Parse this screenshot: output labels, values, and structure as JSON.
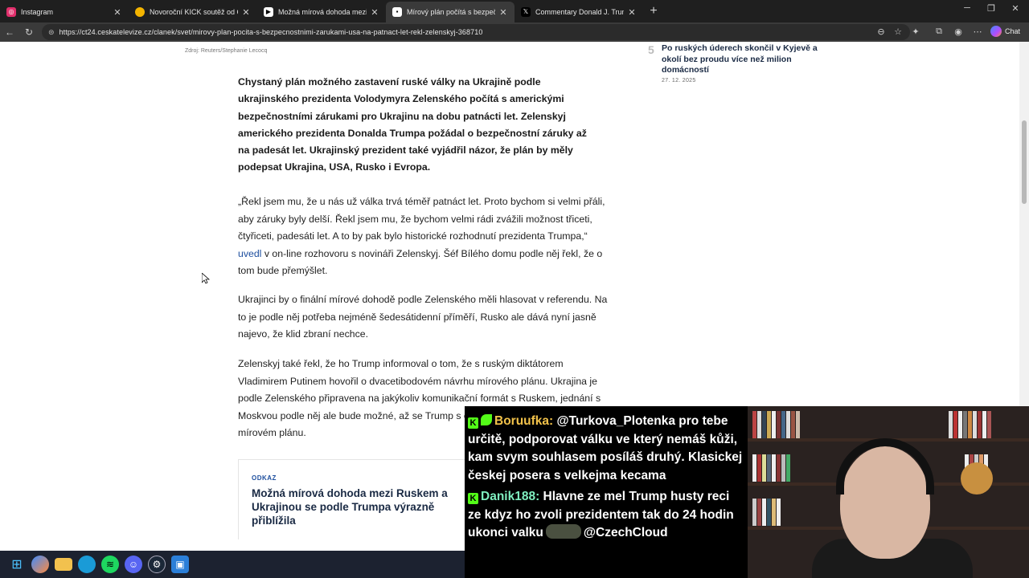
{
  "browser": {
    "tabs": [
      {
        "title": "Instagram",
        "icon": "instagram-icon",
        "color": "#e1306c",
        "active": false
      },
      {
        "title": "Novoroční KICK soutěž od CzechC",
        "icon": "chrome-icon",
        "color": "#f4b400",
        "active": false
      },
      {
        "title": "Možná mírová dohoda mezi Ru",
        "icon": "ct24-icon",
        "color": "#ffffff",
        "active": false
      },
      {
        "title": "Mírový plán počítá s bezpečnos",
        "icon": "ct24-icon",
        "color": "#ffffff",
        "active": true
      },
      {
        "title": "Commentary Donald J. Trump Pos",
        "icon": "x-icon",
        "color": "#000000",
        "active": false
      }
    ],
    "url": "https://ct24.ceskatelevize.cz/clanek/svet/mirovy-plan-pocita-s-bezpecnostnimi-zarukami-usa-na-patnact-let-rekl-zelenskyj-368710",
    "chat_label": "Chat"
  },
  "article": {
    "photo_caption": "Zdroj: Reuters/Stephanie Lecocq",
    "lead": "Chystaný plán možného zastavení ruské války na Ukrajině podle ukrajinského prezidenta Volodymyra Zelenského počítá s americkými bezpečnostními zárukami pro Ukrajinu na dobu patnácti let. Zelenskyj amerického prezidenta Donalda Trumpa požádal o bezpečnostní záruky až na padesát let. Ukrajinský prezident také vyjádřil názor, že plán by měly podepsat Ukrajina, USA, Rusko i Evropa.",
    "p1_quote": "„Řekl jsem mu, že u nás už válka trvá téměř patnáct let. Proto bychom si velmi přáli, aby záruky byly delší. Řekl jsem mu, že bychom velmi rádi zvážili možnost třiceti, čtyřiceti, padesáti let. A to by pak bylo historické rozhodnutí prezidenta Trumpa,“",
    "p1_link": "uvedl",
    "p1_rest": " v on-line rozhovoru s novináři Zelenskyj. Šéf Bílého domu podle něj řekl, že o tom bude přemýšlet.",
    "p2": "Ukrajinci by o finální mírové dohodě podle Zelenského měli hlasovat v referendu. Na to je podle něj potřeba nejméně šedesátidenní příměří, Rusko ale dává nyní jasně najevo, že klid zbraní nechce.",
    "p3": "Zelenskyj také řekl, že ho Trump informoval o tom, že s ruským diktátorem Vladimirem Putinem hovořil o dvacetibodovém návrhu mírového plánu. Ukrajina je podle Zelenského připravena na jakýkoliv komunikační formát s Ruskem, jednání s Moskvou podle něj ale bude možné, až se Trump s e",
    "p3_end": "mírovém plánu.",
    "link_card": {
      "tag": "ODKAZ",
      "headline": "Možná mírová dohoda mezi Ruskem a Ukrajinou se podle Trumpa výrazně přiblížila"
    }
  },
  "sidebar": {
    "number": "5",
    "title": "Po ruských úderech skončil v Kyjevě a okolí bez proudu více než milion domácností",
    "date": "27. 12. 2025"
  },
  "stream_chat": [
    {
      "user": "Boruufka",
      "text": "@Turkova_Plotenka pro tebe určitě, podporovat válku ve který nemáš kůži, kam svym souhlasem posíláš druhý. Klasickej českej posera s velkejma kecama"
    },
    {
      "user": "Danik188",
      "text": "Hlavne ze mel Trump husty reci ze kdyz ho zvoli prezidentem tak do 24 hodin ukonci valku",
      "mention": "@CzechCloud"
    }
  ],
  "taskbar": [
    "windows-icon",
    "copilot-icon",
    "file-explorer-icon",
    "edge-icon",
    "spotify-icon",
    "discord-icon",
    "steam-icon",
    "app-icon"
  ]
}
